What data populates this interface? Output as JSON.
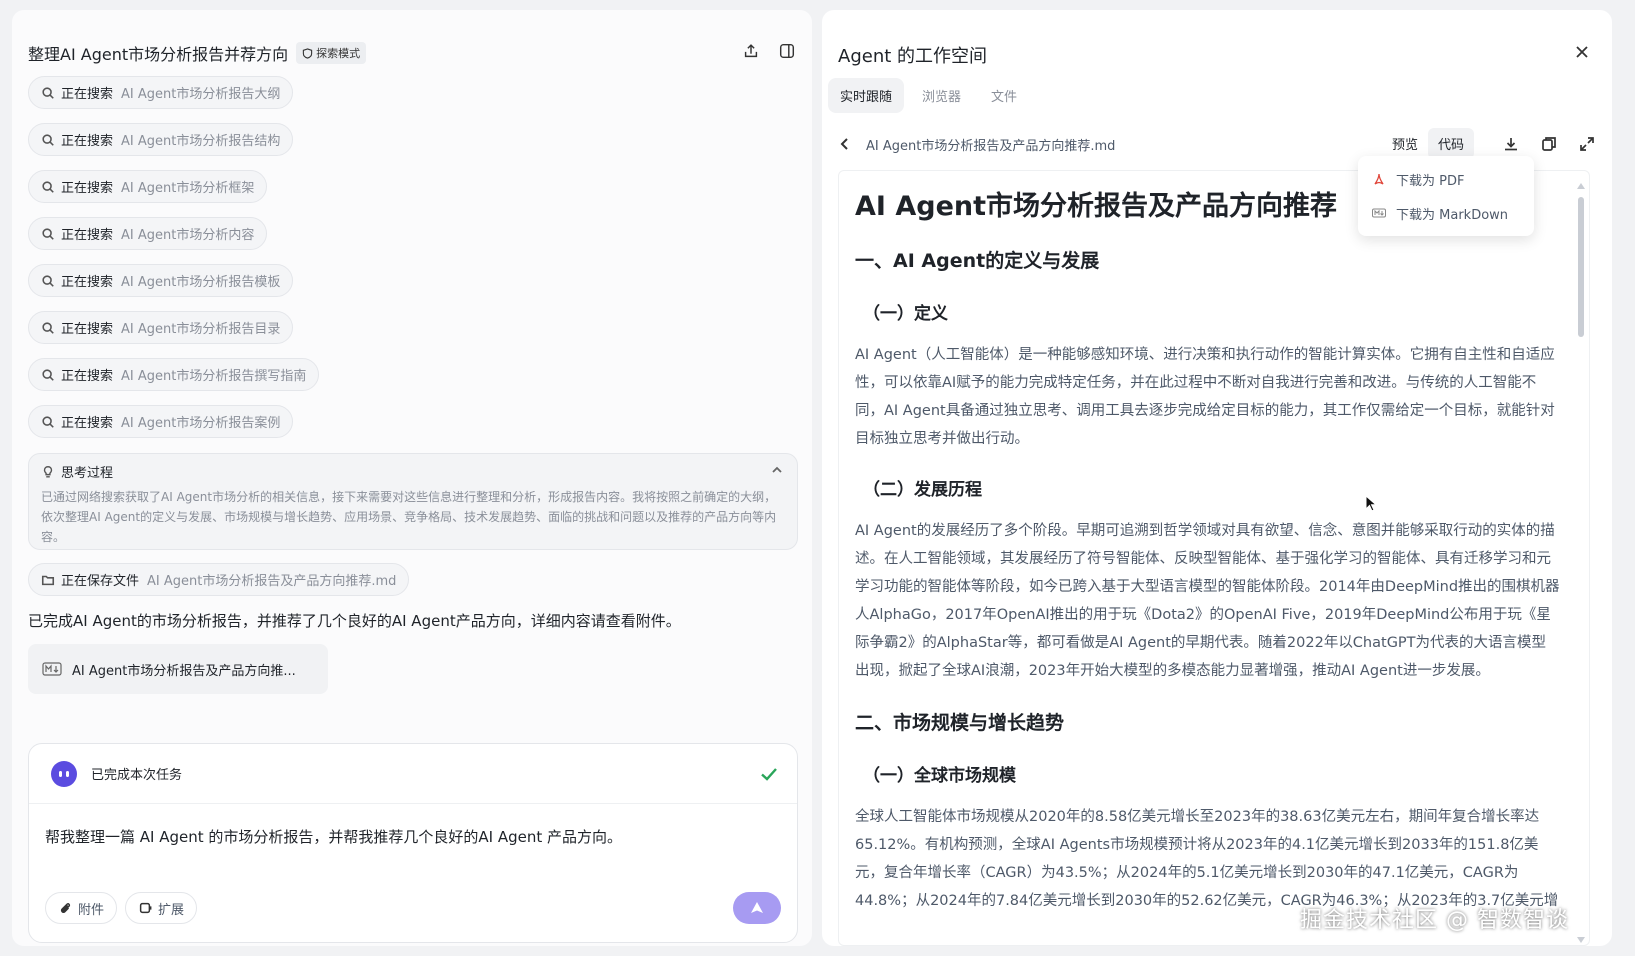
{
  "left": {
    "title": "整理AI Agent市场分析报告并荐方向",
    "mode_badge": "探索模式",
    "steps": [
      {
        "verb": "正在搜索",
        "query": "AI Agent市场分析报告大纲"
      },
      {
        "verb": "正在搜索",
        "query": "AI Agent市场分析报告结构"
      },
      {
        "verb": "正在搜索",
        "query": "AI Agent市场分析框架"
      },
      {
        "verb": "正在搜索",
        "query": "AI Agent市场分析内容"
      },
      {
        "verb": "正在搜索",
        "query": "AI Agent市场分析报告模板"
      },
      {
        "verb": "正在搜索",
        "query": "AI Agent市场分析报告目录"
      },
      {
        "verb": "正在搜索",
        "query": "AI Agent市场分析报告撰写指南"
      },
      {
        "verb": "正在搜索",
        "query": "AI Agent市场分析报告案例"
      }
    ],
    "thinking": {
      "title": "思考过程",
      "body": "已通过网络搜索获取了AI Agent市场分析的相关信息，接下来需要对这些信息进行整理和分析，形成报告内容。我将按照之前确定的大纲，依次整理AI Agent的定义与发展、市场规模与增长趋势、应用场景、竞争格局、技术发展趋势、面临的挑战和问题以及推荐的产品方向等内容。"
    },
    "save_step": {
      "verb": "正在保存文件",
      "query": "AI Agent市场分析报告及产品方向推荐.md"
    },
    "summary": "已完成AI Agent的市场分析报告，并推荐了几个良好的AI Agent产品方向，详细内容请查看附件。",
    "attachment": "AI Agent市场分析报告及产品方向推...",
    "task": {
      "status": "已完成本次任务",
      "prompt": "帮我整理一篇 AI Agent 的市场分析报告，并帮我推荐几个良好的AI Agent 产品方向。",
      "attach_label": "附件",
      "expand_label": "扩展"
    }
  },
  "right": {
    "title": "Agent 的工作空间",
    "tabs": [
      "实时跟随",
      "浏览器",
      "文件"
    ],
    "file_name": "AI Agent市场分析报告及产品方向推荐.md",
    "view_preview": "预览",
    "view_code": "代码",
    "dropdown": [
      "下载为 PDF",
      "下载为 MarkDown"
    ],
    "doc": {
      "h1": "AI Agent市场分析报告及产品方向推荐",
      "s1": "一、AI Agent的定义与发展",
      "s1_1": "（一）定义",
      "p1": "AI Agent（人工智能体）是一种能够感知环境、进行决策和执行动作的智能计算实体。它拥有自主性和自适应性，可以依靠AI赋予的能力完成特定任务，并在此过程中不断对自我进行完善和改进。与传统的人工智能不同，AI Agent具备通过独立思考、调用工具去逐步完成给定目标的能力，其工作仅需给定一个目标，就能针对目标独立思考并做出行动。",
      "s1_2": "（二）发展历程",
      "p2": "AI Agent的发展经历了多个阶段。早期可追溯到哲学领域对具有欲望、信念、意图并能够采取行动的实体的描述。在人工智能领域，其发展经历了符号智能体、反映型智能体、基于强化学习的智能体、具有迁移学习和元学习功能的智能体等阶段，如今已跨入基于大型语言模型的智能体阶段。2014年由DeepMind推出的围棋机器人AlphaGo，2017年OpenAI推出的用于玩《Dota2》的OpenAI Five，2019年DeepMind公布用于玩《星际争霸2》的AlphaStar等，都可看做是AI Agent的早期代表。随着2022年以ChatGPT为代表的大语言模型出现，掀起了全球AI浪潮，2023年开始大模型的多模态能力显著增强，推动AI Agent进一步发展。",
      "s2": "二、市场规模与增长趋势",
      "s2_1": "（一）全球市场规模",
      "p3": "全球人工智能体市场规模从2020年的8.58亿美元增长至2023年的38.63亿美元左右，期间年复合增长率达65.12%。有机构预测，全球AI Agents市场规模预计将从2023年的4.1亿美元增长到2033年的151.8亿美元，复合年增长率（CAGR）为43.5%；从2024年的5.1亿美元增长到2030年的47.1亿美元，CAGR为44.8%；从2024年的7.84亿美元增长到2030年的52.62亿美元，CAGR为46.3%；从2023年的3.7亿美元增"
    },
    "watermark": "掘金技术社区 @ 智数智谈"
  }
}
